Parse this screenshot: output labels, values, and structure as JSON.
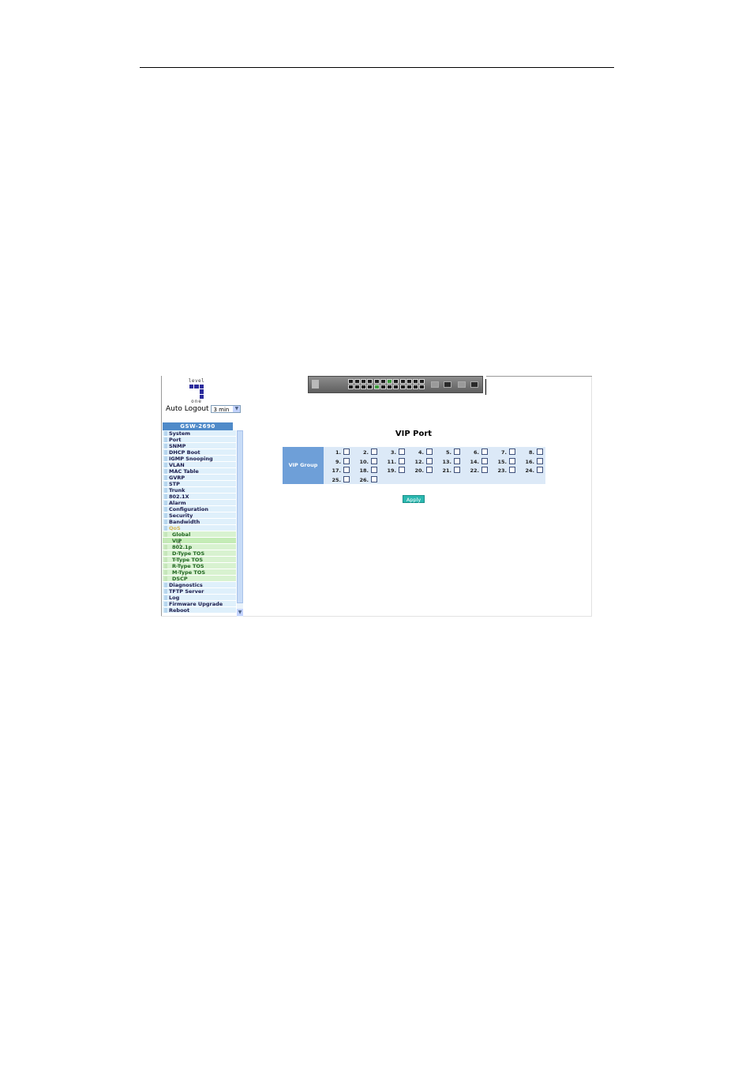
{
  "logo": {
    "top_text": "level",
    "bottom_text": "one"
  },
  "auto_logout": {
    "label": "Auto Logout",
    "selected": "3 min"
  },
  "device": {
    "model": "GSW-2690"
  },
  "menu": [
    {
      "label": "System",
      "type": "item"
    },
    {
      "label": "Port",
      "type": "item"
    },
    {
      "label": "SNMP",
      "type": "item"
    },
    {
      "label": "DHCP Boot",
      "type": "item"
    },
    {
      "label": "IGMP Snooping",
      "type": "item"
    },
    {
      "label": "VLAN",
      "type": "item"
    },
    {
      "label": "MAC Table",
      "type": "item"
    },
    {
      "label": "GVRP",
      "type": "item"
    },
    {
      "label": "STP",
      "type": "item"
    },
    {
      "label": "Trunk",
      "type": "item"
    },
    {
      "label": "802.1X",
      "type": "item"
    },
    {
      "label": "Alarm",
      "type": "item"
    },
    {
      "label": "Configuration",
      "type": "item"
    },
    {
      "label": "Security",
      "type": "item"
    },
    {
      "label": "Bandwidth",
      "type": "item"
    },
    {
      "label": "QoS",
      "type": "item",
      "expanded": true
    },
    {
      "label": "Global",
      "type": "sub"
    },
    {
      "label": "VIP",
      "type": "sub",
      "active": true
    },
    {
      "label": "802.1p",
      "type": "sub"
    },
    {
      "label": "D-Type TOS",
      "type": "sub"
    },
    {
      "label": "T-Type TOS",
      "type": "sub"
    },
    {
      "label": "R-Type TOS",
      "type": "sub"
    },
    {
      "label": "M-Type TOS",
      "type": "sub"
    },
    {
      "label": "DSCP",
      "type": "sub"
    },
    {
      "label": "Diagnostics",
      "type": "item"
    },
    {
      "label": "TFTP Server",
      "type": "item"
    },
    {
      "label": "Log",
      "type": "item"
    },
    {
      "label": "Firmware Upgrade",
      "type": "item"
    },
    {
      "label": "Reboot",
      "type": "item"
    }
  ],
  "main": {
    "title": "VIP Port",
    "group_label": "VIP Group",
    "ports": [
      "1.",
      "2.",
      "3.",
      "4.",
      "5.",
      "6.",
      "7.",
      "8.",
      "9.",
      "10.",
      "11.",
      "12.",
      "13.",
      "14.",
      "15.",
      "16.",
      "17.",
      "18.",
      "19.",
      "20.",
      "21.",
      "22.",
      "23.",
      "24.",
      "25.",
      "26."
    ],
    "apply_label": "Apply"
  },
  "colors": {
    "menu_bg": "#dff0fb",
    "submenu_bg": "#d8f2d0",
    "header_blue": "#4f8ac9",
    "apply_teal": "#2bb8b0"
  }
}
